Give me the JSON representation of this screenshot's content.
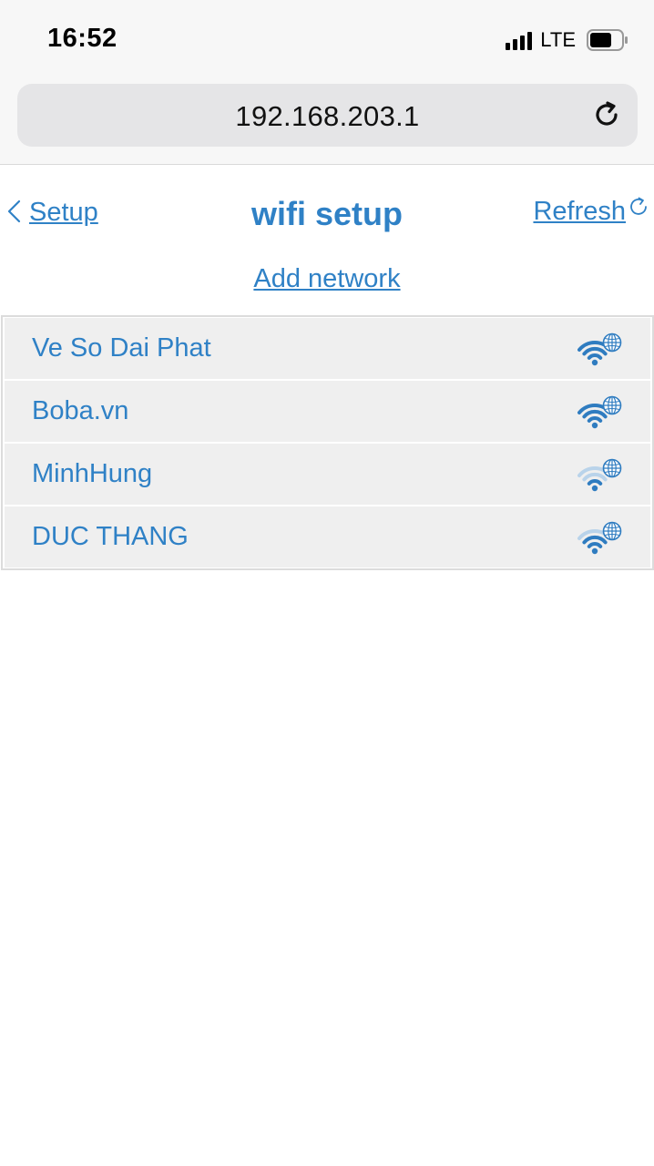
{
  "status_bar": {
    "time": "16:52",
    "network_type": "LTE",
    "signal_icon": "cellular-signal-icon",
    "battery_icon": "battery-icon"
  },
  "browser": {
    "url": "192.168.203.1",
    "reload_icon": "reload-icon"
  },
  "nav": {
    "back_label": "Setup",
    "title": "wifi setup",
    "refresh_label": "Refresh",
    "add_network_label": "Add network"
  },
  "networks": [
    {
      "name": "Ve So Dai Phat",
      "signal_level": 3
    },
    {
      "name": "Boba.vn",
      "signal_level": 3
    },
    {
      "name": "MinhHung",
      "signal_level": 1
    },
    {
      "name": "DUC THANG",
      "signal_level": 2
    }
  ],
  "colors": {
    "link": "#2f81c6",
    "row_bg": "#efefef",
    "wifi_active": "#2f7cc0",
    "wifi_inactive": "#b9d3ea"
  }
}
